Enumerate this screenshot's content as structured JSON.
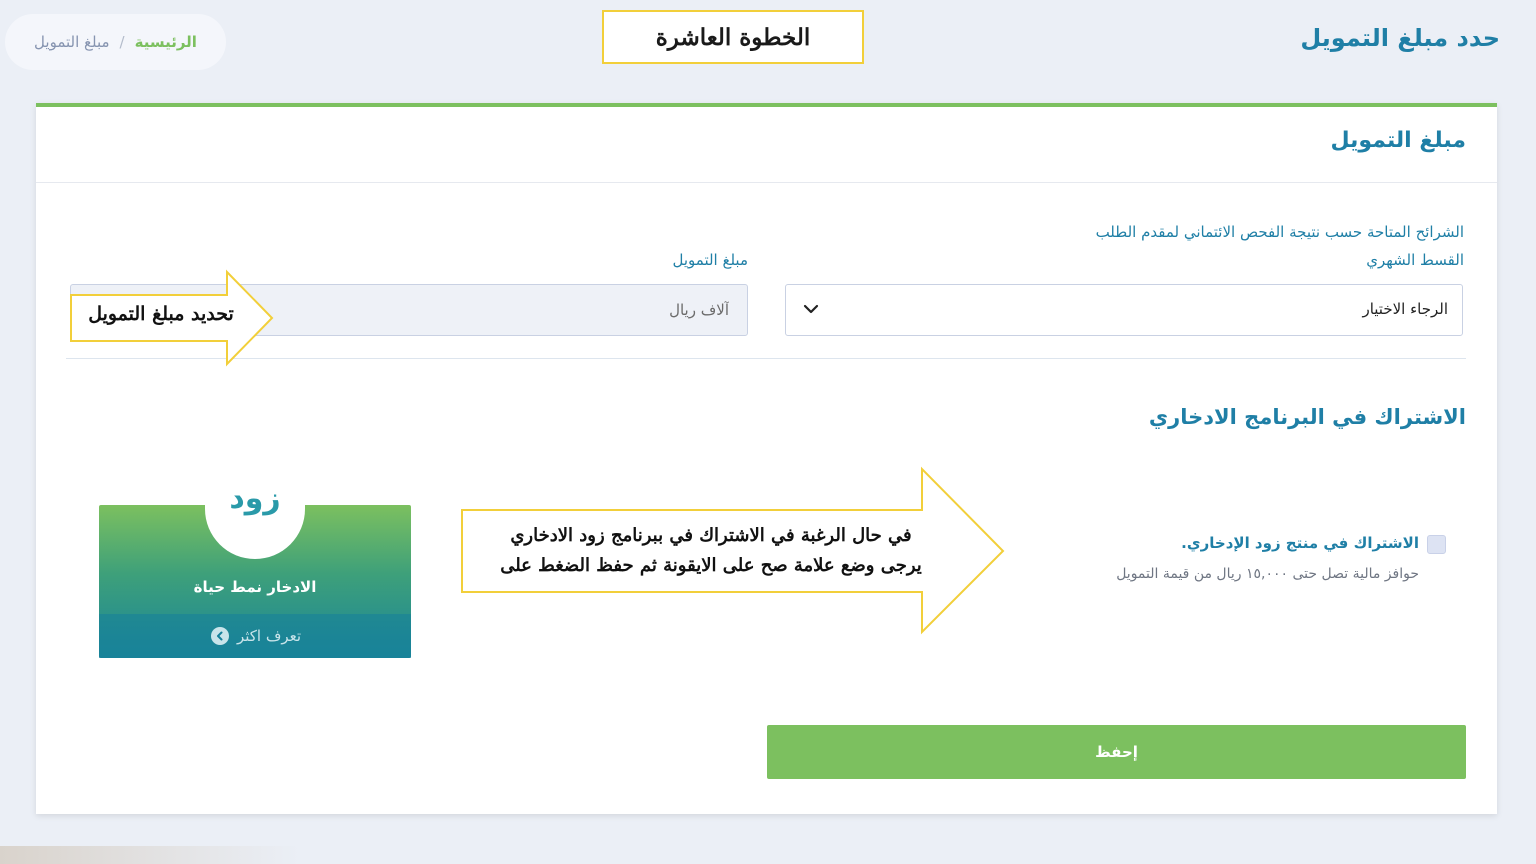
{
  "header": {
    "page_title": "حدد مبلغ التمويل",
    "step_label": "الخطوة العاشرة"
  },
  "breadcrumb": {
    "home": "الرئيسية",
    "separator": "/",
    "current": "مبلغ التمويل"
  },
  "card": {
    "title": "مبلغ التمويل",
    "tiers_label": "الشرائح المتاحة حسب نتيجة الفحص الائتماني لمقدم الطلب",
    "monthly_label": "القسط الشهري",
    "monthly_select_value": "الرجاء الاختيار",
    "amount_label": "مبلغ التمويل",
    "amount_placeholder": "آلاف ريال"
  },
  "savings": {
    "title": "الاشتراك في البرنامج الادخاري",
    "checkbox_label": "الاشتراك في منتج زود الإدخاري.",
    "checkbox_checked": false,
    "incentive_text": "حوافز مالية تصل حتى ١٥,٠٠٠ ريال من قيمة التمويل"
  },
  "zood": {
    "logo_text": "زود",
    "slogan": "الادخار نمط حياة",
    "learn_more": "تعرف اكثر"
  },
  "actions": {
    "save_label": "إحفظ"
  },
  "annotations": {
    "amount_callout": "تحديد مبلغ التمويل",
    "savings_callout_line1": "في حال الرغبة في الاشتراك في ببرنامج زود الادخاري",
    "savings_callout_line2": "يرجى وضع علامة صح على الايقونة ثم حفظ الضغط على"
  },
  "colors": {
    "brand_blue": "#1f7fa6",
    "brand_green": "#7cc05f",
    "annotation_yellow": "#f2cf3a",
    "page_background": "#ebeff6"
  }
}
